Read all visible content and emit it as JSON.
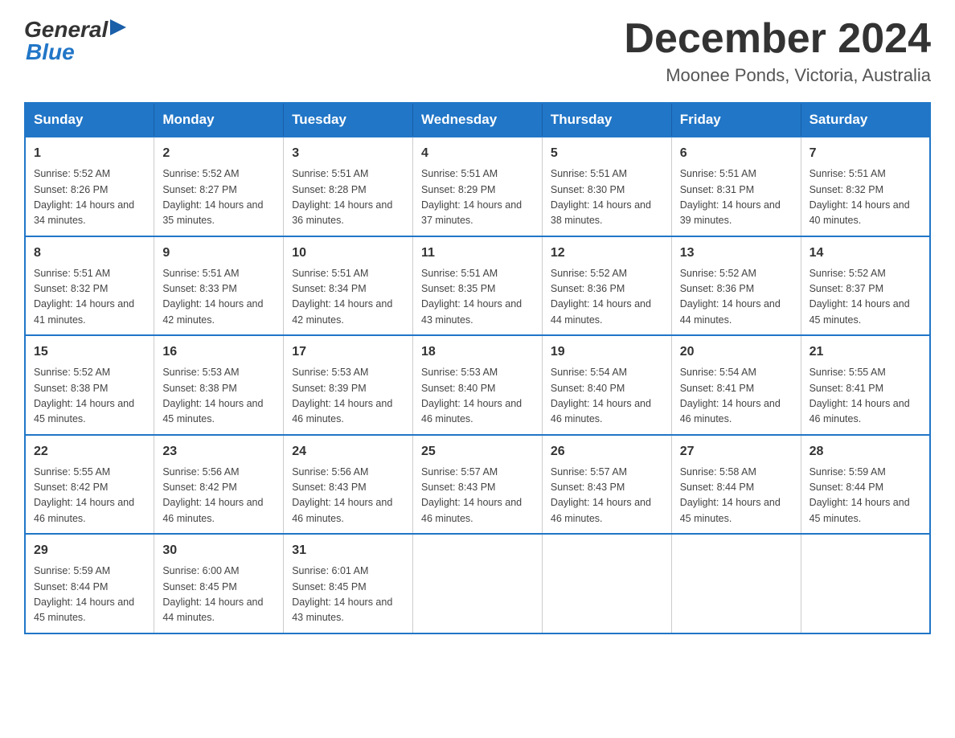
{
  "header": {
    "logo_general": "General",
    "logo_blue": "Blue",
    "title": "December 2024",
    "subtitle": "Moonee Ponds, Victoria, Australia"
  },
  "weekdays": [
    "Sunday",
    "Monday",
    "Tuesday",
    "Wednesday",
    "Thursday",
    "Friday",
    "Saturday"
  ],
  "weeks": [
    [
      {
        "day": "1",
        "sunrise": "5:52 AM",
        "sunset": "8:26 PM",
        "daylight": "14 hours and 34 minutes."
      },
      {
        "day": "2",
        "sunrise": "5:52 AM",
        "sunset": "8:27 PM",
        "daylight": "14 hours and 35 minutes."
      },
      {
        "day": "3",
        "sunrise": "5:51 AM",
        "sunset": "8:28 PM",
        "daylight": "14 hours and 36 minutes."
      },
      {
        "day": "4",
        "sunrise": "5:51 AM",
        "sunset": "8:29 PM",
        "daylight": "14 hours and 37 minutes."
      },
      {
        "day": "5",
        "sunrise": "5:51 AM",
        "sunset": "8:30 PM",
        "daylight": "14 hours and 38 minutes."
      },
      {
        "day": "6",
        "sunrise": "5:51 AM",
        "sunset": "8:31 PM",
        "daylight": "14 hours and 39 minutes."
      },
      {
        "day": "7",
        "sunrise": "5:51 AM",
        "sunset": "8:32 PM",
        "daylight": "14 hours and 40 minutes."
      }
    ],
    [
      {
        "day": "8",
        "sunrise": "5:51 AM",
        "sunset": "8:32 PM",
        "daylight": "14 hours and 41 minutes."
      },
      {
        "day": "9",
        "sunrise": "5:51 AM",
        "sunset": "8:33 PM",
        "daylight": "14 hours and 42 minutes."
      },
      {
        "day": "10",
        "sunrise": "5:51 AM",
        "sunset": "8:34 PM",
        "daylight": "14 hours and 42 minutes."
      },
      {
        "day": "11",
        "sunrise": "5:51 AM",
        "sunset": "8:35 PM",
        "daylight": "14 hours and 43 minutes."
      },
      {
        "day": "12",
        "sunrise": "5:52 AM",
        "sunset": "8:36 PM",
        "daylight": "14 hours and 44 minutes."
      },
      {
        "day": "13",
        "sunrise": "5:52 AM",
        "sunset": "8:36 PM",
        "daylight": "14 hours and 44 minutes."
      },
      {
        "day": "14",
        "sunrise": "5:52 AM",
        "sunset": "8:37 PM",
        "daylight": "14 hours and 45 minutes."
      }
    ],
    [
      {
        "day": "15",
        "sunrise": "5:52 AM",
        "sunset": "8:38 PM",
        "daylight": "14 hours and 45 minutes."
      },
      {
        "day": "16",
        "sunrise": "5:53 AM",
        "sunset": "8:38 PM",
        "daylight": "14 hours and 45 minutes."
      },
      {
        "day": "17",
        "sunrise": "5:53 AM",
        "sunset": "8:39 PM",
        "daylight": "14 hours and 46 minutes."
      },
      {
        "day": "18",
        "sunrise": "5:53 AM",
        "sunset": "8:40 PM",
        "daylight": "14 hours and 46 minutes."
      },
      {
        "day": "19",
        "sunrise": "5:54 AM",
        "sunset": "8:40 PM",
        "daylight": "14 hours and 46 minutes."
      },
      {
        "day": "20",
        "sunrise": "5:54 AM",
        "sunset": "8:41 PM",
        "daylight": "14 hours and 46 minutes."
      },
      {
        "day": "21",
        "sunrise": "5:55 AM",
        "sunset": "8:41 PM",
        "daylight": "14 hours and 46 minutes."
      }
    ],
    [
      {
        "day": "22",
        "sunrise": "5:55 AM",
        "sunset": "8:42 PM",
        "daylight": "14 hours and 46 minutes."
      },
      {
        "day": "23",
        "sunrise": "5:56 AM",
        "sunset": "8:42 PM",
        "daylight": "14 hours and 46 minutes."
      },
      {
        "day": "24",
        "sunrise": "5:56 AM",
        "sunset": "8:43 PM",
        "daylight": "14 hours and 46 minutes."
      },
      {
        "day": "25",
        "sunrise": "5:57 AM",
        "sunset": "8:43 PM",
        "daylight": "14 hours and 46 minutes."
      },
      {
        "day": "26",
        "sunrise": "5:57 AM",
        "sunset": "8:43 PM",
        "daylight": "14 hours and 46 minutes."
      },
      {
        "day": "27",
        "sunrise": "5:58 AM",
        "sunset": "8:44 PM",
        "daylight": "14 hours and 45 minutes."
      },
      {
        "day": "28",
        "sunrise": "5:59 AM",
        "sunset": "8:44 PM",
        "daylight": "14 hours and 45 minutes."
      }
    ],
    [
      {
        "day": "29",
        "sunrise": "5:59 AM",
        "sunset": "8:44 PM",
        "daylight": "14 hours and 45 minutes."
      },
      {
        "day": "30",
        "sunrise": "6:00 AM",
        "sunset": "8:45 PM",
        "daylight": "14 hours and 44 minutes."
      },
      {
        "day": "31",
        "sunrise": "6:01 AM",
        "sunset": "8:45 PM",
        "daylight": "14 hours and 43 minutes."
      },
      null,
      null,
      null,
      null
    ]
  ]
}
